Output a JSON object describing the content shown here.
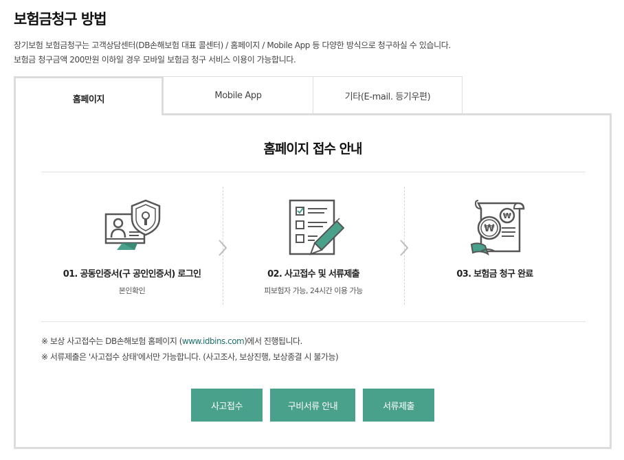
{
  "page": {
    "title": "보험금청구 방법",
    "intro_line1": "장기보험 보험금청구는 고객상담센터(DB손해보험 대표 콜센터) / 홈페이지 / Mobile App 등 다양한 방식으로 청구하실 수 있습니다.",
    "intro_line2": "보험금 청구금액 200만원 이하일 경우 모바일 보험금 청구 서비스 이용이 가능합니다."
  },
  "tabs": [
    {
      "label": "홈페이지",
      "active": true
    },
    {
      "label": "Mobile App",
      "active": false
    },
    {
      "label": "기타(E-mail. 등기우편)",
      "active": false
    }
  ],
  "panel": {
    "title": "홈페이지 접수 안내",
    "steps": [
      {
        "title": "01. 공동인증서(구 공인인증서) 로그인",
        "subtitle": "본인확인",
        "icon": "computer-shield-icon"
      },
      {
        "title": "02. 사고접수 및 서류제출",
        "subtitle": "피보험자 가능, 24시간 이용 가능",
        "icon": "checklist-pencil-icon"
      },
      {
        "title": "03. 보험금 청구 완료",
        "subtitle": "",
        "icon": "won-coin-receipt-icon"
      }
    ],
    "notes": {
      "line1_prefix": "※ 보상 사고접수는 DB손해보험 홈페이지 (",
      "line1_link": "www.idbins.com",
      "line1_suffix": ")에서 진행됩니다.",
      "line2": "※ 서류제출은 '사고접수 상태'에서만 가능합니다. (사고조사, 보상진행, 보상종결 시 불가능)"
    },
    "buttons": {
      "accident": "사고접수",
      "documents_guide": "구비서류 안내",
      "submit": "서류제출"
    }
  },
  "colors": {
    "accent": "#4aa18b",
    "icon_stroke": "#555555",
    "border": "#dcdcdc"
  }
}
